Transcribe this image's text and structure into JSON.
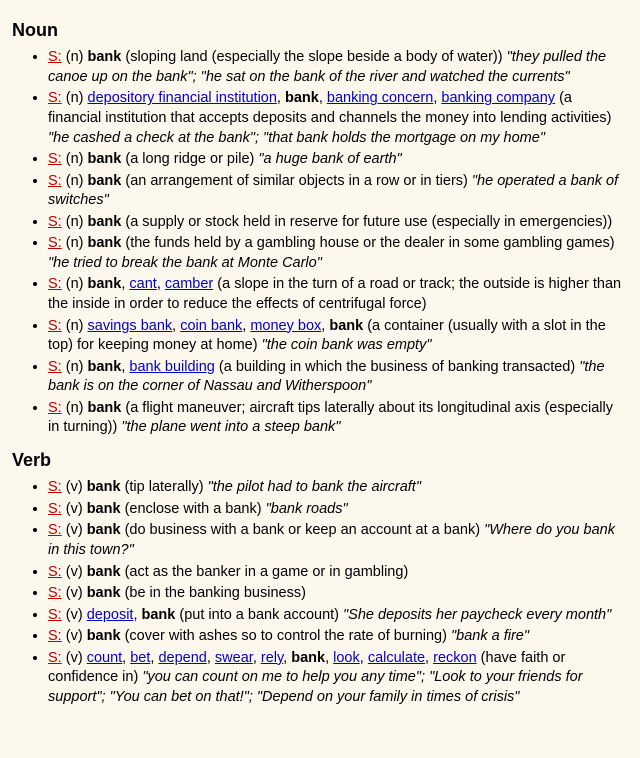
{
  "sections": [
    {
      "pos": "Noun",
      "marker": "(n)",
      "senses": [
        {
          "synset": [
            {
              "text": "bank",
              "link": false,
              "bold": true
            }
          ],
          "gloss": "(sloping land (especially the slope beside a body of water))",
          "example": "\"they pulled the canoe up on the bank\"; \"he sat on the bank of the river and watched the currents\""
        },
        {
          "synset": [
            {
              "text": "depository financial institution",
              "link": true,
              "bold": false
            },
            {
              "text": "bank",
              "link": false,
              "bold": true
            },
            {
              "text": "banking concern",
              "link": true,
              "bold": false
            },
            {
              "text": "banking company",
              "link": true,
              "bold": false
            }
          ],
          "gloss": "(a financial institution that accepts deposits and channels the money into lending activities)",
          "example": "\"he cashed a check at the bank\"; \"that bank holds the mortgage on my home\""
        },
        {
          "synset": [
            {
              "text": "bank",
              "link": false,
              "bold": true
            }
          ],
          "gloss": "(a long ridge or pile)",
          "example": "\"a huge bank of earth\""
        },
        {
          "synset": [
            {
              "text": "bank",
              "link": false,
              "bold": true
            }
          ],
          "gloss": "(an arrangement of similar objects in a row or in tiers)",
          "example": "\"he operated a bank of switches\""
        },
        {
          "synset": [
            {
              "text": "bank",
              "link": false,
              "bold": true
            }
          ],
          "gloss": "(a supply or stock held in reserve for future use (especially in emergencies))",
          "example": ""
        },
        {
          "synset": [
            {
              "text": "bank",
              "link": false,
              "bold": true
            }
          ],
          "gloss": "(the funds held by a gambling house or the dealer in some gambling games)",
          "example": "\"he tried to break the bank at Monte Carlo\""
        },
        {
          "synset": [
            {
              "text": "bank",
              "link": false,
              "bold": true
            },
            {
              "text": "cant",
              "link": true,
              "bold": false
            },
            {
              "text": "camber",
              "link": true,
              "bold": false
            }
          ],
          "gloss": "(a slope in the turn of a road or track; the outside is higher than the inside in order to reduce the effects of centrifugal force)",
          "example": ""
        },
        {
          "synset": [
            {
              "text": "savings bank",
              "link": true,
              "bold": false
            },
            {
              "text": "coin bank",
              "link": true,
              "bold": false
            },
            {
              "text": "money box",
              "link": true,
              "bold": false
            },
            {
              "text": "bank",
              "link": false,
              "bold": true
            }
          ],
          "gloss": "(a container (usually with a slot in the top) for keeping money at home)",
          "example": "\"the coin bank was empty\""
        },
        {
          "synset": [
            {
              "text": "bank",
              "link": false,
              "bold": true
            },
            {
              "text": "bank building",
              "link": true,
              "bold": false
            }
          ],
          "gloss": "(a building in which the business of banking transacted)",
          "example": "\"the bank is on the corner of Nassau and Witherspoon\""
        },
        {
          "synset": [
            {
              "text": "bank",
              "link": false,
              "bold": true
            }
          ],
          "gloss": "(a flight maneuver; aircraft tips laterally about its longitudinal axis (especially in turning))",
          "example": "\"the plane went into a steep bank\""
        }
      ]
    },
    {
      "pos": "Verb",
      "marker": "(v)",
      "senses": [
        {
          "synset": [
            {
              "text": "bank",
              "link": false,
              "bold": true
            }
          ],
          "gloss": "(tip laterally)",
          "example": "\"the pilot had to bank the aircraft\""
        },
        {
          "synset": [
            {
              "text": "bank",
              "link": false,
              "bold": true
            }
          ],
          "gloss": "(enclose with a bank)",
          "example": "\"bank roads\""
        },
        {
          "synset": [
            {
              "text": "bank",
              "link": false,
              "bold": true
            }
          ],
          "gloss": "(do business with a bank or keep an account at a bank)",
          "example": "\"Where do you bank in this town?\""
        },
        {
          "synset": [
            {
              "text": "bank",
              "link": false,
              "bold": true
            }
          ],
          "gloss": "(act as the banker in a game or in gambling)",
          "example": ""
        },
        {
          "synset": [
            {
              "text": "bank",
              "link": false,
              "bold": true
            }
          ],
          "gloss": "(be in the banking business)",
          "example": ""
        },
        {
          "synset": [
            {
              "text": "deposit",
              "link": true,
              "bold": false
            },
            {
              "text": "bank",
              "link": false,
              "bold": true
            }
          ],
          "gloss": "(put into a bank account)",
          "example": "\"She deposits her paycheck every month\""
        },
        {
          "synset": [
            {
              "text": "bank",
              "link": false,
              "bold": true
            }
          ],
          "gloss": "(cover with ashes so to control the rate of burning)",
          "example": "\"bank a fire\""
        },
        {
          "synset": [
            {
              "text": "count",
              "link": true,
              "bold": false
            },
            {
              "text": "bet",
              "link": true,
              "bold": false
            },
            {
              "text": "depend",
              "link": true,
              "bold": false
            },
            {
              "text": "swear",
              "link": true,
              "bold": false
            },
            {
              "text": "rely",
              "link": true,
              "bold": false
            },
            {
              "text": "bank",
              "link": false,
              "bold": true
            },
            {
              "text": "look",
              "link": true,
              "bold": false
            },
            {
              "text": "calculate",
              "link": true,
              "bold": false
            },
            {
              "text": "reckon",
              "link": true,
              "bold": false
            }
          ],
          "gloss": "(have faith or confidence in)",
          "example": "\"you can count on me to help you any time\"; \"Look to your friends for support\"; \"You can bet on that!\"; \"Depend on your family in times of crisis\""
        }
      ]
    }
  ],
  "s_label": "S:"
}
